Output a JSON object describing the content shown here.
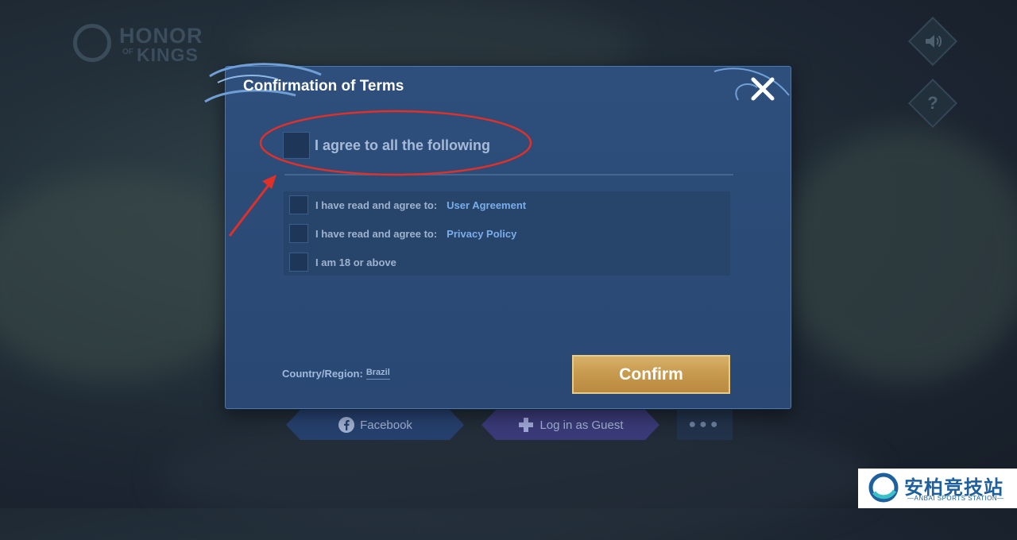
{
  "background": {
    "game_logo": {
      "line1": "HONOR",
      "of": "OF",
      "line2": "KINGS"
    },
    "side_buttons": {
      "sound_icon": "speaker-icon",
      "help_label": "?"
    },
    "login": {
      "facebook_label": "Facebook",
      "guest_label": "Log in as Guest",
      "more_label": "●●●"
    }
  },
  "dialog": {
    "title": "Confirmation of Terms",
    "agree_all_label": "I agree to all the following",
    "options": [
      {
        "text": "I have read and agree to:",
        "link": "User Agreement"
      },
      {
        "text": "I have read and agree to:",
        "link": "Privacy Policy"
      },
      {
        "text": "I am 18 or above"
      }
    ],
    "country_label": "Country/Region:",
    "country_value": "Brazil",
    "confirm_label": "Confirm"
  },
  "watermark": {
    "cn_text": "安柏竞技站",
    "en_text": "—ANBAI SPORTS STATION—"
  },
  "colors": {
    "dialog_bg": "#2c4c78",
    "confirm_gold": "#c89b4f",
    "link_blue": "#79aeea",
    "annotation_red": "#e0302a"
  }
}
